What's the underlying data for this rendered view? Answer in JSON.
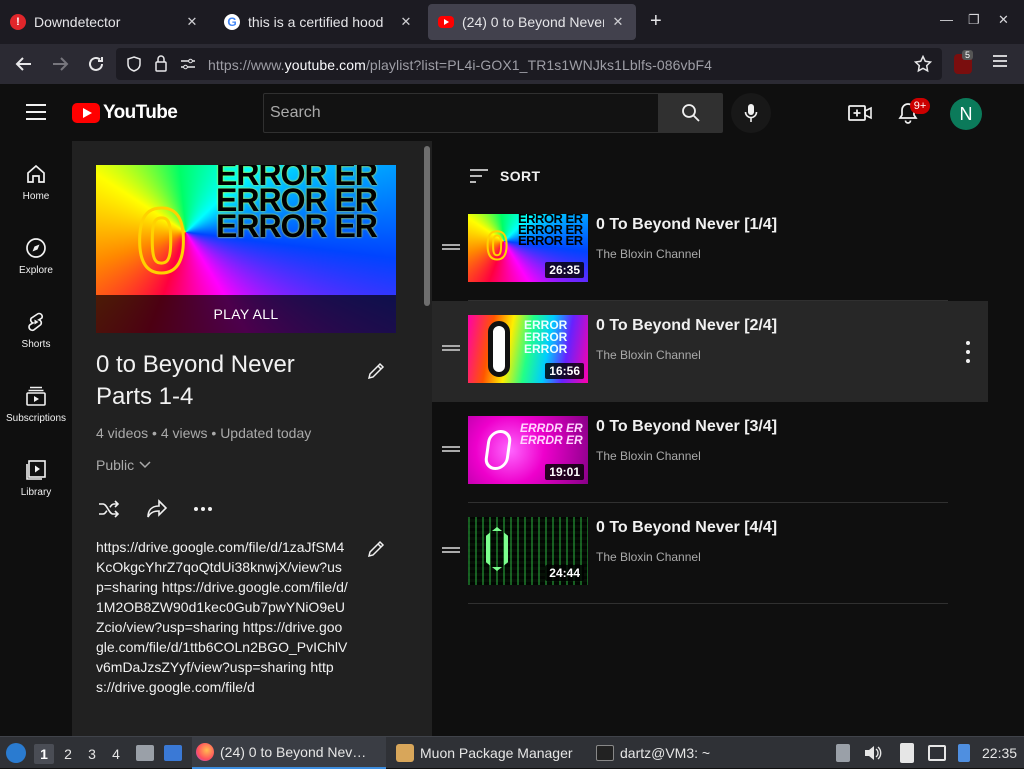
{
  "browser": {
    "tabs": [
      {
        "title": "Downdetector",
        "favicon": "alert-icon"
      },
      {
        "title": "this is a certified hood",
        "favicon": "google-icon"
      },
      {
        "title": "(24) 0 to Beyond Never",
        "favicon": "youtube-icon",
        "active": true
      }
    ],
    "new_tab": "+",
    "url_prefix": "https://www.",
    "url_domain": "youtube.com",
    "url_rest": "/playlist?list=PL4i-GOX1_TR1s1WNJks1Lblfs-086vbF4",
    "extension_badge": "5"
  },
  "youtube": {
    "logo_text": "YouTube",
    "search_placeholder": "Search",
    "notification_count": "9+",
    "avatar_letter": "N"
  },
  "guide": [
    {
      "label": "Home",
      "icon": "home-icon"
    },
    {
      "label": "Explore",
      "icon": "compass-icon"
    },
    {
      "label": "Shorts",
      "icon": "shorts-icon"
    },
    {
      "label": "Subscriptions",
      "icon": "subscriptions-icon"
    },
    {
      "label": "Library",
      "icon": "library-icon"
    }
  ],
  "playlist": {
    "play_all": "PLAY ALL",
    "title": "0 to Beyond Never Parts 1-4",
    "meta": "4 videos • 4 views • Updated today",
    "privacy": "Public",
    "description": "https://drive.google.com/file/d/1zaJfSM4KcOkgcYhrZ7qoQtdUi38knwjX/view?usp=sharing https://drive.google.com/file/d/1M2OB8ZW90d1kec0Gub7pwYNiO9eUZcio/view?usp=sharing https://drive.google.com/file/d/1ttb6COLn2BGO_PvIChlVv6mDaJzsZYyf/view?usp=sharing https://drive.google.com/file/d",
    "thumb_text": "ERROR ER"
  },
  "list": {
    "sort_label": "SORT",
    "videos": [
      {
        "title": "0 To Beyond Never [1/4]",
        "channel": "The Bloxin Channel",
        "duration": "26:35",
        "thumb_text": "ERROR ER"
      },
      {
        "title": "0 To Beyond Never [2/4]",
        "channel": "The Bloxin Channel",
        "duration": "16:56",
        "thumb_text": "ERROR"
      },
      {
        "title": "0 To Beyond Never [3/4]",
        "channel": "The Bloxin Channel",
        "duration": "19:01",
        "thumb_text": "ERRDR ER"
      },
      {
        "title": "0 To Beyond Never [4/4]",
        "channel": "The Bloxin Channel",
        "duration": "24:44",
        "thumb_text": ""
      }
    ]
  },
  "taskbar": {
    "workspaces": [
      "1",
      "2",
      "3",
      "4"
    ],
    "windows": [
      {
        "title": "(24) 0 to Beyond Nev…",
        "icon": "firefox-icon"
      },
      {
        "title": "Muon Package Manager",
        "icon": "package-icon"
      },
      {
        "title": "dartz@VM3: ~",
        "icon": "terminal-icon"
      }
    ],
    "clock": "22:35"
  },
  "colors": {
    "youtube_red": "#ff0000",
    "accent_badge": "#cc0000",
    "avatar": "#0b7a5a"
  }
}
